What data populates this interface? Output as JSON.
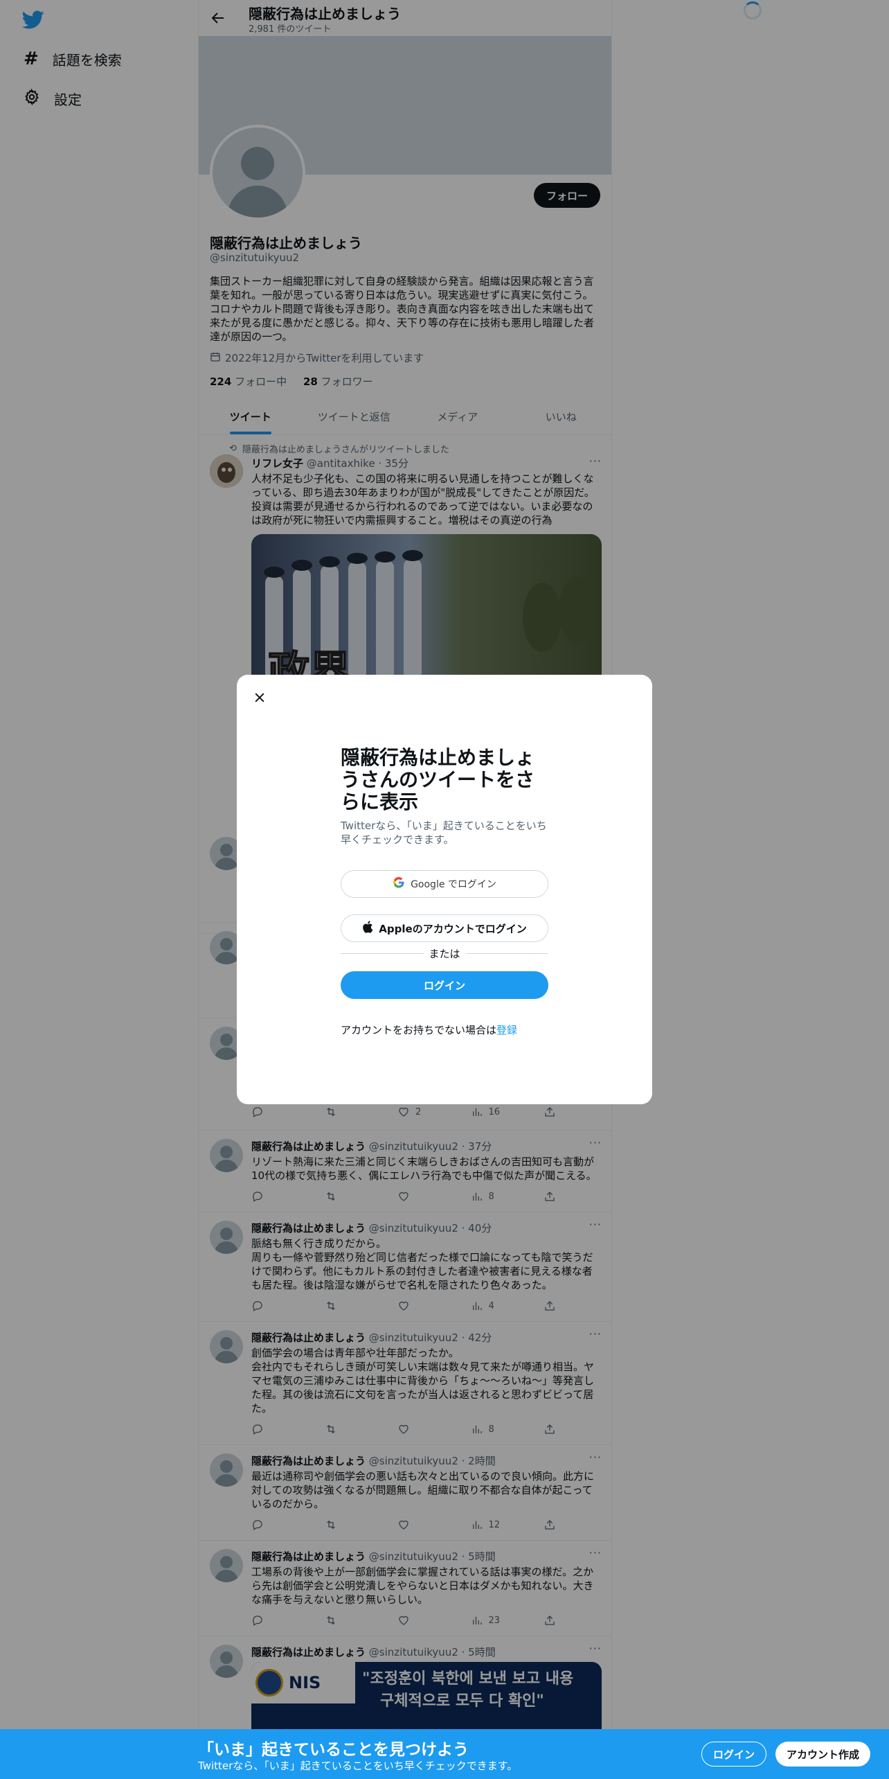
{
  "sidebar": {
    "items": [
      {
        "label": "話題を検索",
        "icon": "hashtag-icon"
      },
      {
        "label": "設定",
        "icon": "gear-icon"
      }
    ]
  },
  "header": {
    "title": "隠蔽行為は止めましょう",
    "tweet_count": "2,981 件のツイート"
  },
  "profile": {
    "name": "隠蔽行為は止めましょう",
    "handle": "@sinzitutuikyuu2",
    "follow_label": "フォロー",
    "bio": "集団ストーカー組織犯罪に対して自身の経験談から発言。組織は因果応報と言う言葉を知れ。一般が思っている寄り日本は危うい。現実逃避せずに真実に気付こう。コロナやカルト問題で背後も浮き彫り。表向き真面な内容を呟き出した末端も出て来たが見る度に愚かだと感じる。抑々、天下り等の存在に技術も悪用し暗躍した者達が原因の一つ。",
    "joined": "2022年12月からTwitterを利用しています",
    "following_count": "224",
    "following_label": "フォロー中",
    "followers_count": "28",
    "followers_label": "フォロワー"
  },
  "tabs": [
    "ツイート",
    "ツイートと返信",
    "メディア",
    "いいね"
  ],
  "retweet": {
    "context": "隠蔽行為は止めましょうさんがリツイートしました",
    "name": "リフレ女子",
    "handle": "@antitaxhike",
    "time": "35分",
    "text": "人材不足も少子化も、この国の将来に明るい見通しを持つことが難しくなっている、即ち過去30年あまりわが国が\"脱成長\"してきたことが原因だ。投資は需要が見通せるから行われるのであって逆ではない。いま必要なのは政府が死に物狂いで内需振興すること。増税はその真逆の行為"
  },
  "tweets": [
    {
      "name": "隠蔽行為は止めましょう",
      "handle": "@sinzitutuikyuu2",
      "time": "37分",
      "text": "リゾート熱海に来た三浦と同じく末端らしきおばさんの吉田知可も言動が10代の様で気持ち悪く、偶にエレハラ行為でも中傷で似た声が聞こえる。",
      "likes": "",
      "views": "8"
    },
    {
      "name": "隠蔽行為は止めましょう",
      "handle": "@sinzitutuikyuu2",
      "time": "40分",
      "text": "脈絡も無く行き成りだから。\n周りも一條や菅野然り殆ど同じ信者だった様で口論になっても陰で笑うだけで関わらず。他にもカルト系の封付きした者達や被害者に見える様な者も居た程。後は陰湿な嫌がらせで名札を隠されたり色々あった。",
      "likes": "",
      "views": "4"
    },
    {
      "name": "隠蔽行為は止めましょう",
      "handle": "@sinzitutuikyuu2",
      "time": "42分",
      "text": "創価学会の場合は青年部や壮年部だったか。\n会社内でもそれらしき頭が可笑しい末端は数々見て来たが噂通り相当。ヤマセ電気の三浦ゆみこは仕事中に背後から「ちょ〜〜ろいね〜」等発言した程。其の後は流石に文句を言ったが当人は返されると思わずビビって居た。",
      "likes": "",
      "views": "8"
    },
    {
      "name": "隠蔽行為は止めましょう",
      "handle": "@sinzitutuikyuu2",
      "time": "2時間",
      "text": "最近は通称司や創価学会の悪い話も次々と出ているので良い傾向。此方に対しての攻勢は強くなるが問題無し。組織に取り不都合な自体が起こっているのだから。",
      "likes": "",
      "views": "12"
    },
    {
      "name": "隠蔽行為は止めましょう",
      "handle": "@sinzitutuikyuu2",
      "time": "5時間",
      "text": "工場系の背後や上が一部創価学会に掌握されている話は事実の様だ。之から先は創価学会と公明党潰しをやらないと日本はダメかも知れない。大きな痛手を与えないと懲り無いらしい。",
      "likes": "",
      "views": "23"
    },
    {
      "name": "隠蔽行為は止めましょう",
      "handle": "@sinzitutuikyuu2",
      "time": "5時間",
      "text": "",
      "likes": "",
      "views": ""
    }
  ],
  "partial_tweet_stats": {
    "likes": "2",
    "views": "16"
  },
  "image_overlay_text": "政界",
  "nis_image": {
    "logo": "NIS",
    "line1": "\"조정훈이 북한에 보낸 보고 내용",
    "line2": "구체적으로 모두 다 확인\""
  },
  "modal": {
    "title": "隠蔽行為は止めましょうさんのツイートをさらに表示",
    "subtitle": "Twitterなら、「いま」起きていることをいち早くチェックできます。",
    "google_label": "Google でログイン",
    "apple_label": "Appleのアカウントでログイン",
    "or_label": "または",
    "login_label": "ログイン",
    "signup_prefix": "アカウントをお持ちでない場合は",
    "signup_link": "登録"
  },
  "bottom_bar": {
    "title": "「いま」起きていることを見つけよう",
    "subtitle": "Twitterなら、「いま」起きていることをいち早くチェックできます。",
    "login_label": "ログイン",
    "signup_label": "アカウント作成"
  },
  "colors": {
    "accent": "#1d9bf0",
    "text": "#0f1419",
    "muted": "#536471"
  }
}
